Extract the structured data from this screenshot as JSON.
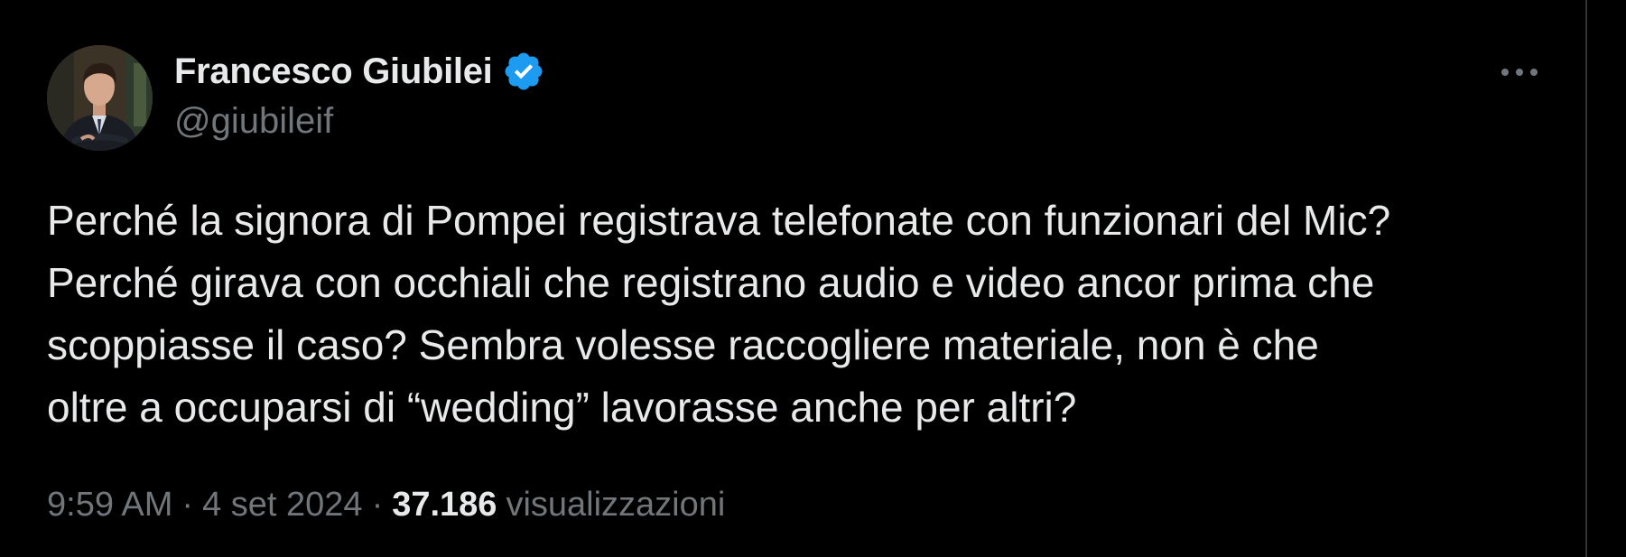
{
  "tweet": {
    "author": {
      "display_name": "Francesco Giubilei",
      "handle": "@giubileif",
      "verified": true
    },
    "text_lines": [
      "Perché la signora di Pompei registrava telefonate con funzionari del Mic?",
      "Perché girava con occhiali che registrano audio e video ancor prima che",
      "scoppiasse il caso? Sembra volesse raccogliere materiale, non è che",
      "oltre a occuparsi di “wedding” lavorasse anche per altri?"
    ],
    "time": "9:59 AM",
    "separator": "·",
    "date": "4 set 2024",
    "views_count": "37.186",
    "views_label": "visualizzazioni"
  },
  "icons": {
    "verified": "verified-badge-icon",
    "more": "more-options-icon"
  },
  "colors": {
    "background": "#000000",
    "text_primary": "#e7e9ea",
    "text_secondary": "#71767b",
    "verified_blue": "#1d9bf0",
    "divider": "#2f3336"
  }
}
